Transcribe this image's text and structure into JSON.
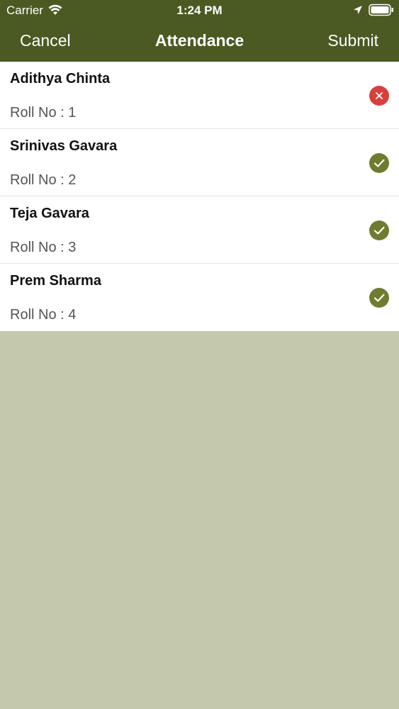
{
  "status_bar": {
    "carrier": "Carrier",
    "time": "1:24 PM"
  },
  "nav": {
    "cancel_label": "Cancel",
    "title": "Attendance",
    "submit_label": "Submit"
  },
  "colors": {
    "nav_background": "#4b5a23",
    "present": "#6f7b2f",
    "absent": "#d9403b",
    "empty_background": "#c4c9ae"
  },
  "students": [
    {
      "name": "Adithya Chinta",
      "roll": "Roll No : 1",
      "status": "absent",
      "icon": "close-icon"
    },
    {
      "name": "Srinivas Gavara",
      "roll": "Roll No : 2",
      "status": "present",
      "icon": "check-icon"
    },
    {
      "name": "Teja Gavara",
      "roll": "Roll No : 3",
      "status": "present",
      "icon": "check-icon"
    },
    {
      "name": "Prem Sharma",
      "roll": "Roll No : 4",
      "status": "present",
      "icon": "check-icon"
    }
  ]
}
